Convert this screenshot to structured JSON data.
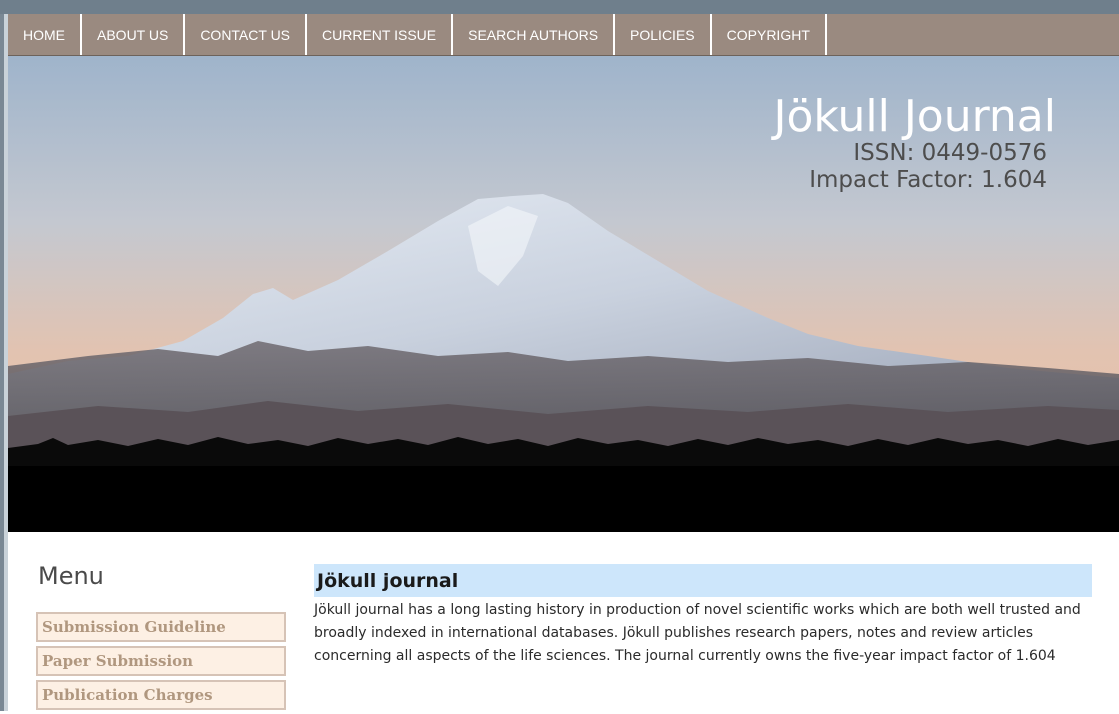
{
  "nav": {
    "items": [
      {
        "label": "HOME"
      },
      {
        "label": "ABOUT US"
      },
      {
        "label": "CONTACT US"
      },
      {
        "label": "CURRENT ISSUE"
      },
      {
        "label": "SEARCH AUTHORS"
      },
      {
        "label": "POLICIES"
      },
      {
        "label": "COPYRIGHT"
      }
    ]
  },
  "hero": {
    "title": "Jökull Journal",
    "issn": "ISSN: 0449-0576",
    "impact": "Impact Factor: 1.604"
  },
  "menu": {
    "heading": "Menu",
    "items": [
      {
        "label": "Submission Guideline"
      },
      {
        "label": "Paper Submission"
      },
      {
        "label": "Publication Charges"
      }
    ]
  },
  "content": {
    "title": "Jökull journal",
    "body": "Jökull journal has a long lasting history in production of novel scientific works which are both well trusted and broadly indexed in international databases. Jökull publishes research papers, notes and review articles concerning all aspects of the life sciences. The journal currently owns the five-year impact factor of 1.604"
  },
  "colors": {
    "nav_bg": "#9a8a80",
    "title_band": "#cde6fb",
    "menu_item_bg": "#fdf0e4",
    "menu_item_text": "#b0977f"
  }
}
